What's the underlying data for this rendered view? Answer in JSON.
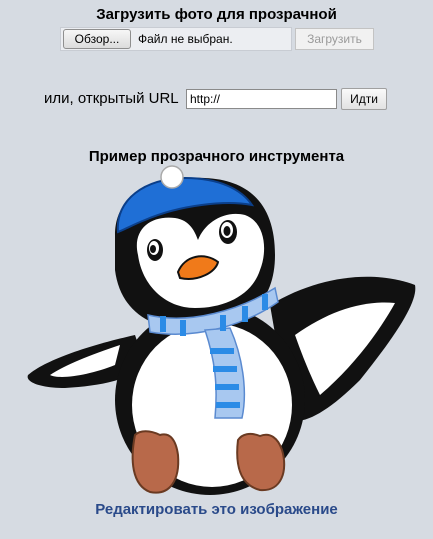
{
  "upload": {
    "title": "Загрузить фото для прозрачной",
    "browse_label": "Обзор...",
    "file_status": "Файл не выбран.",
    "submit_label": "Загрузить"
  },
  "url": {
    "label": "или, открытый URL",
    "value": "http://",
    "go_label": "Идти"
  },
  "example": {
    "title": "Пример прозрачного инструмента",
    "image_icon": "penguin-illustration",
    "edit_link": "Редактировать это изображение"
  },
  "colors": {
    "background": "#d6dbe2",
    "link": "#2a4a8a",
    "hat": "#1f6fd6",
    "scarf": "#2b8be6",
    "beak": "#f07a1a",
    "feet": "#b8694a"
  }
}
